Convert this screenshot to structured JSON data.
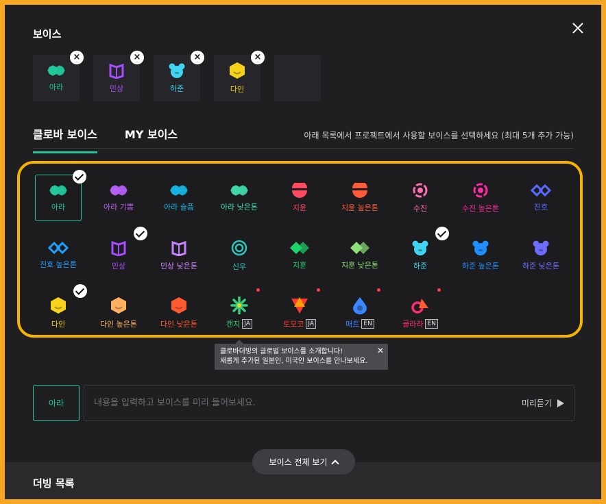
{
  "modal": {
    "section_title": "보이스",
    "close_label": "close"
  },
  "selected": [
    {
      "label": "아라",
      "icon": "ara-icon",
      "color": "#21c89a",
      "shape": "double"
    },
    {
      "label": "민상",
      "icon": "minsang-icon",
      "color": "#a64dff",
      "shape": "book"
    },
    {
      "label": "하준",
      "icon": "hajun-icon",
      "color": "#3fd5f0",
      "shape": "bear"
    },
    {
      "label": "다인",
      "icon": "dain-icon",
      "color": "#f7d21a",
      "shape": "hex"
    }
  ],
  "tabs": [
    {
      "label": "클로바 보이스",
      "active": true
    },
    {
      "label": "MY 보이스",
      "active": false
    }
  ],
  "hint": "아래 목록에서 프로젝트에서 사용할 보이스를 선택하세요 (최대 5개 추가 가능)",
  "voices": [
    {
      "label": "아라",
      "color": "#21c89a",
      "shape": "double",
      "checked": true,
      "active": true
    },
    {
      "label": "아라 기쁨",
      "color": "#b45ef2",
      "shape": "double"
    },
    {
      "label": "아라 슬픔",
      "color": "#17b3e0",
      "shape": "double"
    },
    {
      "label": "아라 낮은톤",
      "color": "#3fd6a8",
      "shape": "double"
    },
    {
      "label": "지윤",
      "color": "#ff4a5f",
      "shape": "bowl"
    },
    {
      "label": "지윤 높은톤",
      "color": "#ff5a3a",
      "shape": "bowl"
    },
    {
      "label": "수진",
      "color": "#ff6fb0",
      "shape": "ring"
    },
    {
      "label": "수진 높은톤",
      "color": "#ff2aa1",
      "shape": "ring"
    },
    {
      "label": "진호",
      "color": "#5a6bff",
      "shape": "chain"
    },
    {
      "label": "진호 높은톤",
      "color": "#1ea0ff",
      "shape": "chain"
    },
    {
      "label": "민상",
      "color": "#a64dff",
      "shape": "book",
      "checked": true
    },
    {
      "label": "민상 낮은톤",
      "color": "#c884ff",
      "shape": "book"
    },
    {
      "label": "신우",
      "color": "#2fc4b8",
      "shape": "target"
    },
    {
      "label": "지훈",
      "color": "#1fd36b",
      "shape": "diamond2"
    },
    {
      "label": "지훈 낮은톤",
      "color": "#8de07a",
      "shape": "diamond2"
    },
    {
      "label": "하준",
      "color": "#3fd5f0",
      "shape": "bear",
      "checked": true
    },
    {
      "label": "하준 높은톤",
      "color": "#1f8fff",
      "shape": "bear"
    },
    {
      "label": "하준 낮은톤",
      "color": "#6c6cff",
      "shape": "bear"
    },
    {
      "label": "다인",
      "color": "#f7d21a",
      "shape": "hex",
      "checked": true
    },
    {
      "label": "다인 높은톤",
      "color": "#ffb060",
      "shape": "hex"
    },
    {
      "label": "다인 낮은톤",
      "color": "#ff5a30",
      "shape": "hex"
    },
    {
      "label": "캔지",
      "color": "#33d17a",
      "shape": "spark",
      "lang": "JA",
      "new": true
    },
    {
      "label": "토모코",
      "color": "#ff3b2f",
      "shape": "tri",
      "lang": "JA",
      "new": true
    },
    {
      "label": "매트",
      "color": "#3a86ff",
      "shape": "drop",
      "lang": "EN",
      "new": true
    },
    {
      "label": "클라라",
      "color": "#ff2d6f",
      "shape": "clara",
      "lang": "EN",
      "new": true
    }
  ],
  "tooltip": {
    "line1": "클로바더빙의 글로벌 보이스를 소개합니다!",
    "line2": "새롭게 추가된 일본인, 미국인 보이스를 만나보세요."
  },
  "preview": {
    "voice_label": "아라",
    "placeholder": "내용을 입력하고 보이스를 미리 들어보세요.",
    "play_label": "미리듣기"
  },
  "view_all_label": "보이스 전체 보기",
  "dubbing_title": "더빙 목록"
}
